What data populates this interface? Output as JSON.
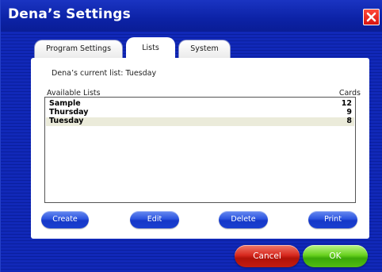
{
  "window": {
    "title": "Dena’s Settings"
  },
  "tabs": [
    {
      "label": "Program Settings",
      "active": false
    },
    {
      "label": "Lists",
      "active": true
    },
    {
      "label": "System",
      "active": false
    }
  ],
  "lists_panel": {
    "current_list_text": "Dena’s current list: Tuesday",
    "column_available": "Available Lists",
    "column_cards": "Cards",
    "rows": [
      {
        "name": "Sample",
        "cards": "12",
        "selected": false
      },
      {
        "name": "Thursday",
        "cards": "9",
        "selected": false
      },
      {
        "name": "Tuesday",
        "cards": "8",
        "selected": true
      }
    ],
    "buttons": {
      "create": "Create",
      "edit": "Edit",
      "delete": "Delete",
      "print": "Print"
    }
  },
  "footer": {
    "cancel": "Cancel",
    "ok": "OK"
  },
  "colors": {
    "background": "#0b1c9a",
    "panel_button": "#2c55e0",
    "cancel_button": "#d82a20",
    "ok_button": "#6ad220",
    "close_button": "#d81410",
    "selected_row": "#ebebda"
  },
  "icons": {
    "close": "close-icon"
  }
}
